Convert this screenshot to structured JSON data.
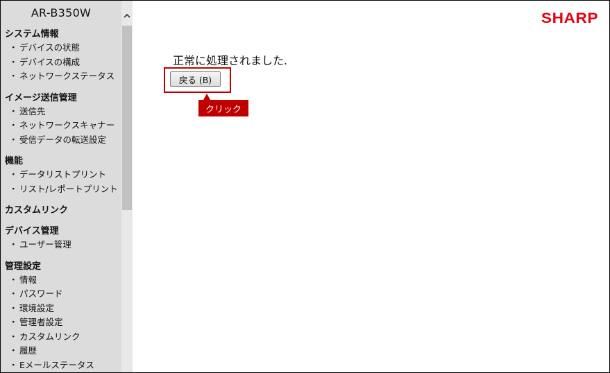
{
  "sidebar": {
    "model_name": "AR-B350W",
    "sections": [
      {
        "title": "システム情報",
        "items": [
          "デバイスの状態",
          "デバイスの構成",
          "ネットワークステータス"
        ]
      },
      {
        "title": "イメージ送信管理",
        "items": [
          "送信先",
          "ネットワークスキャナー",
          "受信データの転送設定"
        ]
      },
      {
        "title": "機能",
        "items": [
          "データリストプリント",
          "リスト/レポートプリント"
        ]
      },
      {
        "title": "カスタムリンク",
        "items": []
      },
      {
        "title": "デバイス管理",
        "items": [
          "ユーザー管理"
        ]
      },
      {
        "title": "管理設定",
        "items": [
          "情報",
          "パスワード",
          "環境設定",
          "管理者設定",
          "カスタムリンク",
          "履歴",
          "Eメールステータス"
        ]
      }
    ],
    "bullet": "・"
  },
  "scrollbar": {
    "up_icon": "chevron-up-icon"
  },
  "header": {
    "logo": "SHARP",
    "brand_color": "#e60012"
  },
  "main": {
    "message": "正常に処理されました.",
    "back_button": "戻る (B)",
    "callout": "クリック",
    "highlight_color": "#c00000"
  }
}
